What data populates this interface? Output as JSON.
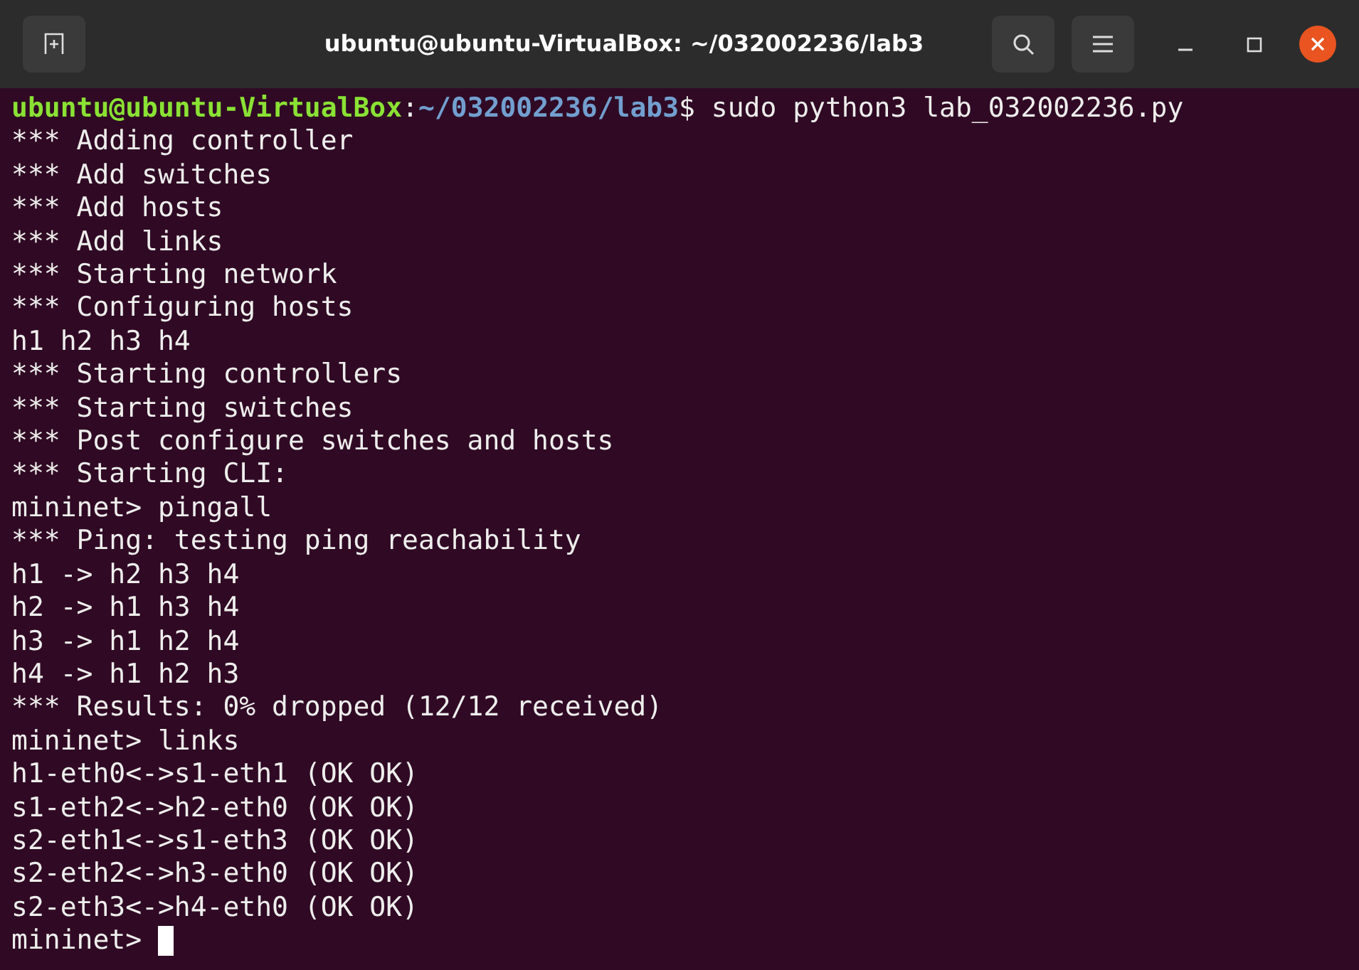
{
  "window": {
    "title": "ubuntu@ubuntu-VirtualBox: ~/032002236/lab3"
  },
  "prompt": {
    "user_host": "ubuntu@ubuntu-VirtualBox",
    "separator": ":",
    "path": "~/032002236/lab3",
    "command": "$ sudo python3 lab_032002236.py"
  },
  "lines": [
    "*** Adding controller",
    "*** Add switches",
    "*** Add hosts",
    "*** Add links",
    "*** Starting network",
    "*** Configuring hosts",
    "h1 h2 h3 h4",
    "*** Starting controllers",
    "*** Starting switches",
    "*** Post configure switches and hosts",
    "*** Starting CLI:",
    "mininet> pingall",
    "*** Ping: testing ping reachability",
    "h1 -> h2 h3 h4",
    "h2 -> h1 h3 h4",
    "h3 -> h1 h2 h4",
    "h4 -> h1 h2 h3",
    "*** Results: 0% dropped (12/12 received)",
    "mininet> links",
    "h1-eth0<->s1-eth1 (OK OK)",
    "s1-eth2<->h2-eth0 (OK OK)",
    "s2-eth1<->s1-eth3 (OK OK)",
    "s2-eth2<->h3-eth0 (OK OK)",
    "s2-eth3<->h4-eth0 (OK OK)"
  ],
  "input_line": {
    "prompt": "mininet>"
  }
}
